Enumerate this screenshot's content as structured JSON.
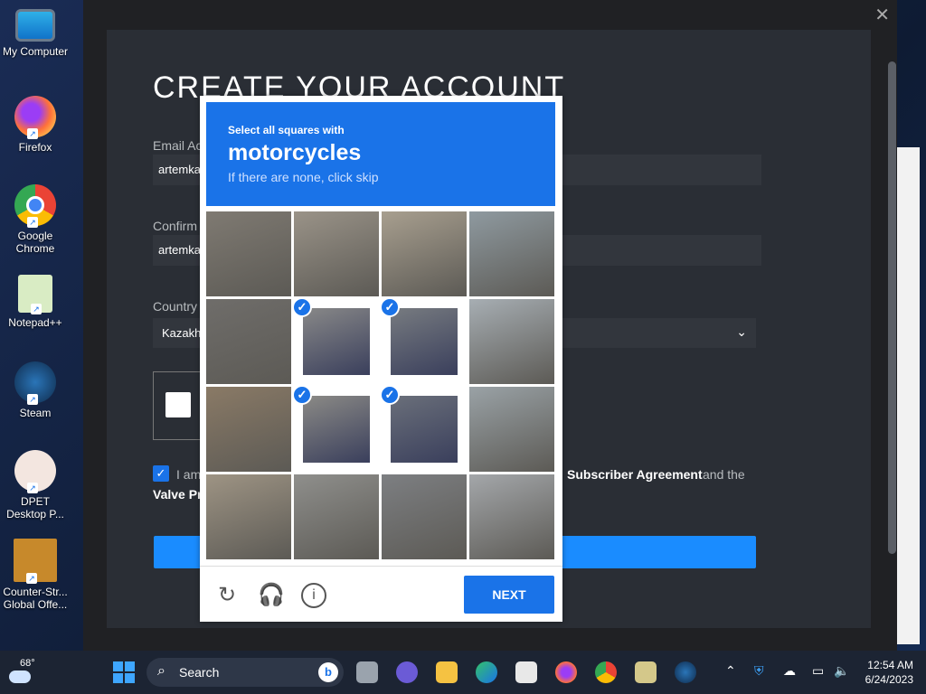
{
  "desktop": {
    "icons": [
      {
        "label": "My Computer"
      },
      {
        "label": "Firefox"
      },
      {
        "label": "Google Chrome"
      },
      {
        "label": "Notepad++"
      },
      {
        "label": "Steam"
      },
      {
        "label": "DPET Desktop P..."
      },
      {
        "label": "Counter-Str... Global Offe..."
      }
    ]
  },
  "steam": {
    "close": "✕",
    "title": "CREATE YOUR ACCOUNT",
    "email_label": "Email Ac",
    "email_value": "artemka",
    "confirm_label": "Confirm",
    "confirm_value": "artemka",
    "country_label": "Country",
    "country_value": "Kazakh",
    "agree_prefix": "I am",
    "agree_link1": "Subscriber Agreement",
    "agree_mid": "and the",
    "agree_link2": "Valve Pr"
  },
  "captcha": {
    "instruction": "Select all squares with",
    "target": "motorcycles",
    "hint": "If there are none, click skip",
    "next_label": "NEXT",
    "selected_tiles": [
      5,
      6,
      9,
      10
    ]
  },
  "taskbar": {
    "weather": "68°",
    "search_placeholder": "Search",
    "time": "12:54 AM",
    "date": "6/24/2023"
  }
}
